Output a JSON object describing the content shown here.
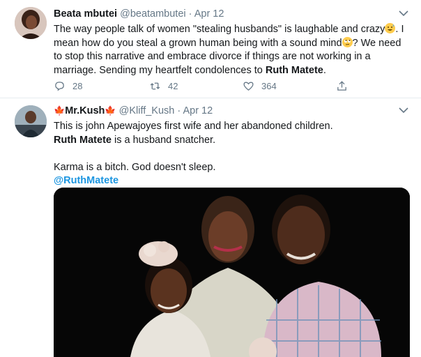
{
  "tweet1": {
    "name": "Beata mbutei",
    "handle": "@beatambutei",
    "sep": " · ",
    "date": "Apr 12",
    "text_a": "The way people talk of women \"stealing husbands\" is laughable and crazy",
    "text_b": ". I mean how do you steal a grown human being with a sound mind",
    "text_c": "? We need to stop this narrative and embrace divorce if things are not working in a marriage. Sending my heartfelt condolences to ",
    "text_bold": "Ruth Matete",
    "text_end": ".",
    "replies": "28",
    "retweets": "42",
    "likes": "364",
    "emoji_1": "grinning-sweat-emoji",
    "emoji_2": "eye-roll-emoji"
  },
  "tweet2": {
    "name": "Mr.Kush",
    "flag_icon": "maple-leaf-icon",
    "handle": "@Kliff_Kush",
    "sep": " · ",
    "date": "Apr 12",
    "line1": "This is john Apewajoyes first wife and her abandoned children.",
    "line2_bold": "Ruth Matete",
    "line2_rest": " is a husband snatcher.",
    "line3": "Karma is a bitch. God doesn't sleep.",
    "mention": "@RuthMatete"
  },
  "colors": {
    "text": "#14171a",
    "meta": "#657786",
    "link": "#1b95e0",
    "divider": "#e6ecf0",
    "flag": "#d0021b"
  }
}
